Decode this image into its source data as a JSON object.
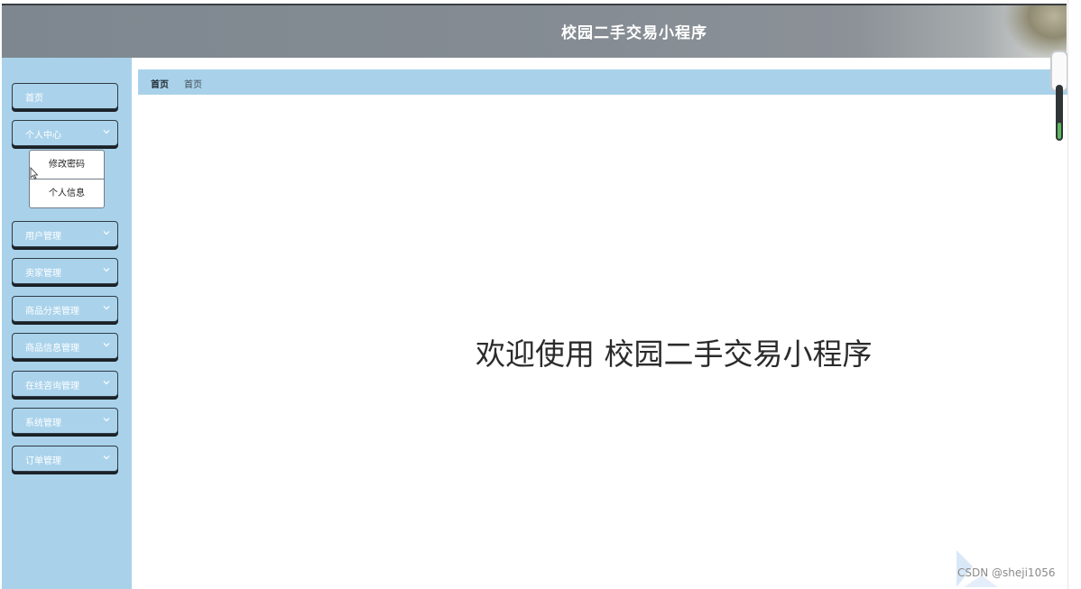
{
  "header": {
    "title": "校园二手交易小程序"
  },
  "sidebar": {
    "items": [
      {
        "label": "首页"
      },
      {
        "label": "个人中心",
        "icon": "chevron-down-icon"
      },
      {
        "label": "用户管理",
        "icon": "chevron-down-icon"
      },
      {
        "label": "卖家管理",
        "icon": "chevron-down-icon"
      },
      {
        "label": "商品分类管理",
        "icon": "chevron-down-icon"
      },
      {
        "label": "商品信息管理",
        "icon": "chevron-down-icon"
      },
      {
        "label": "在线咨询管理",
        "icon": "chevron-down-icon"
      },
      {
        "label": "系统管理",
        "icon": "chevron-down-icon"
      },
      {
        "label": "订单管理",
        "icon": "chevron-down-icon"
      }
    ],
    "submenu": [
      "修改密码",
      "个人信息"
    ]
  },
  "breadcrumb": {
    "home": "首页",
    "current": "首页"
  },
  "main": {
    "welcome": "欢迎使用 校园二手交易小程序"
  },
  "watermark": "CSDN @sheji1056",
  "colors": {
    "sidebar_bg": "#a9d2ea",
    "header_bg": "#858c93",
    "accent": "#5cb85c"
  }
}
